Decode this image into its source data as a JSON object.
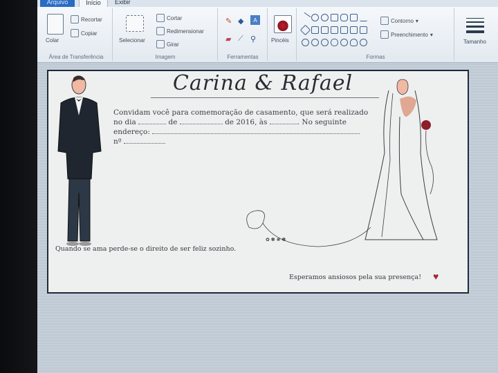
{
  "ribbon": {
    "tabs": [
      "Arquivo",
      "Início",
      "Exibir"
    ],
    "clipboard": {
      "paste": "Colar",
      "cut": "Recortar",
      "copy": "Copiar",
      "label": "Área de Transferência"
    },
    "image": {
      "select": "Selecionar",
      "crop": "Cortar",
      "resize": "Redimensionar",
      "rotate": "Girar",
      "label": "Imagem"
    },
    "tools": {
      "label": "Ferramentas"
    },
    "brushes": {
      "label": "Pincéis"
    },
    "shapes": {
      "outline": "Contorno",
      "fill": "Preenchimento",
      "label": "Formas"
    },
    "size": {
      "label": "Tamanho"
    }
  },
  "card": {
    "title": "Carina & Rafael",
    "line1": "Convidam você para comemoração de casamento, que será realizado",
    "line2_a": "no dia",
    "line2_b": "de",
    "line2_c": "de 2016, às",
    "line2_d": ". No seguinte",
    "line3": "endereço:",
    "line4": "nº",
    "footer_left": "Quando se ama perde-se o direito de ser feliz sozinho.",
    "footer_right": "Esperamos ansiosos pela sua presença!"
  },
  "colors": {
    "heart": "#a1283a",
    "accent_tab": "#2a6bc2"
  }
}
